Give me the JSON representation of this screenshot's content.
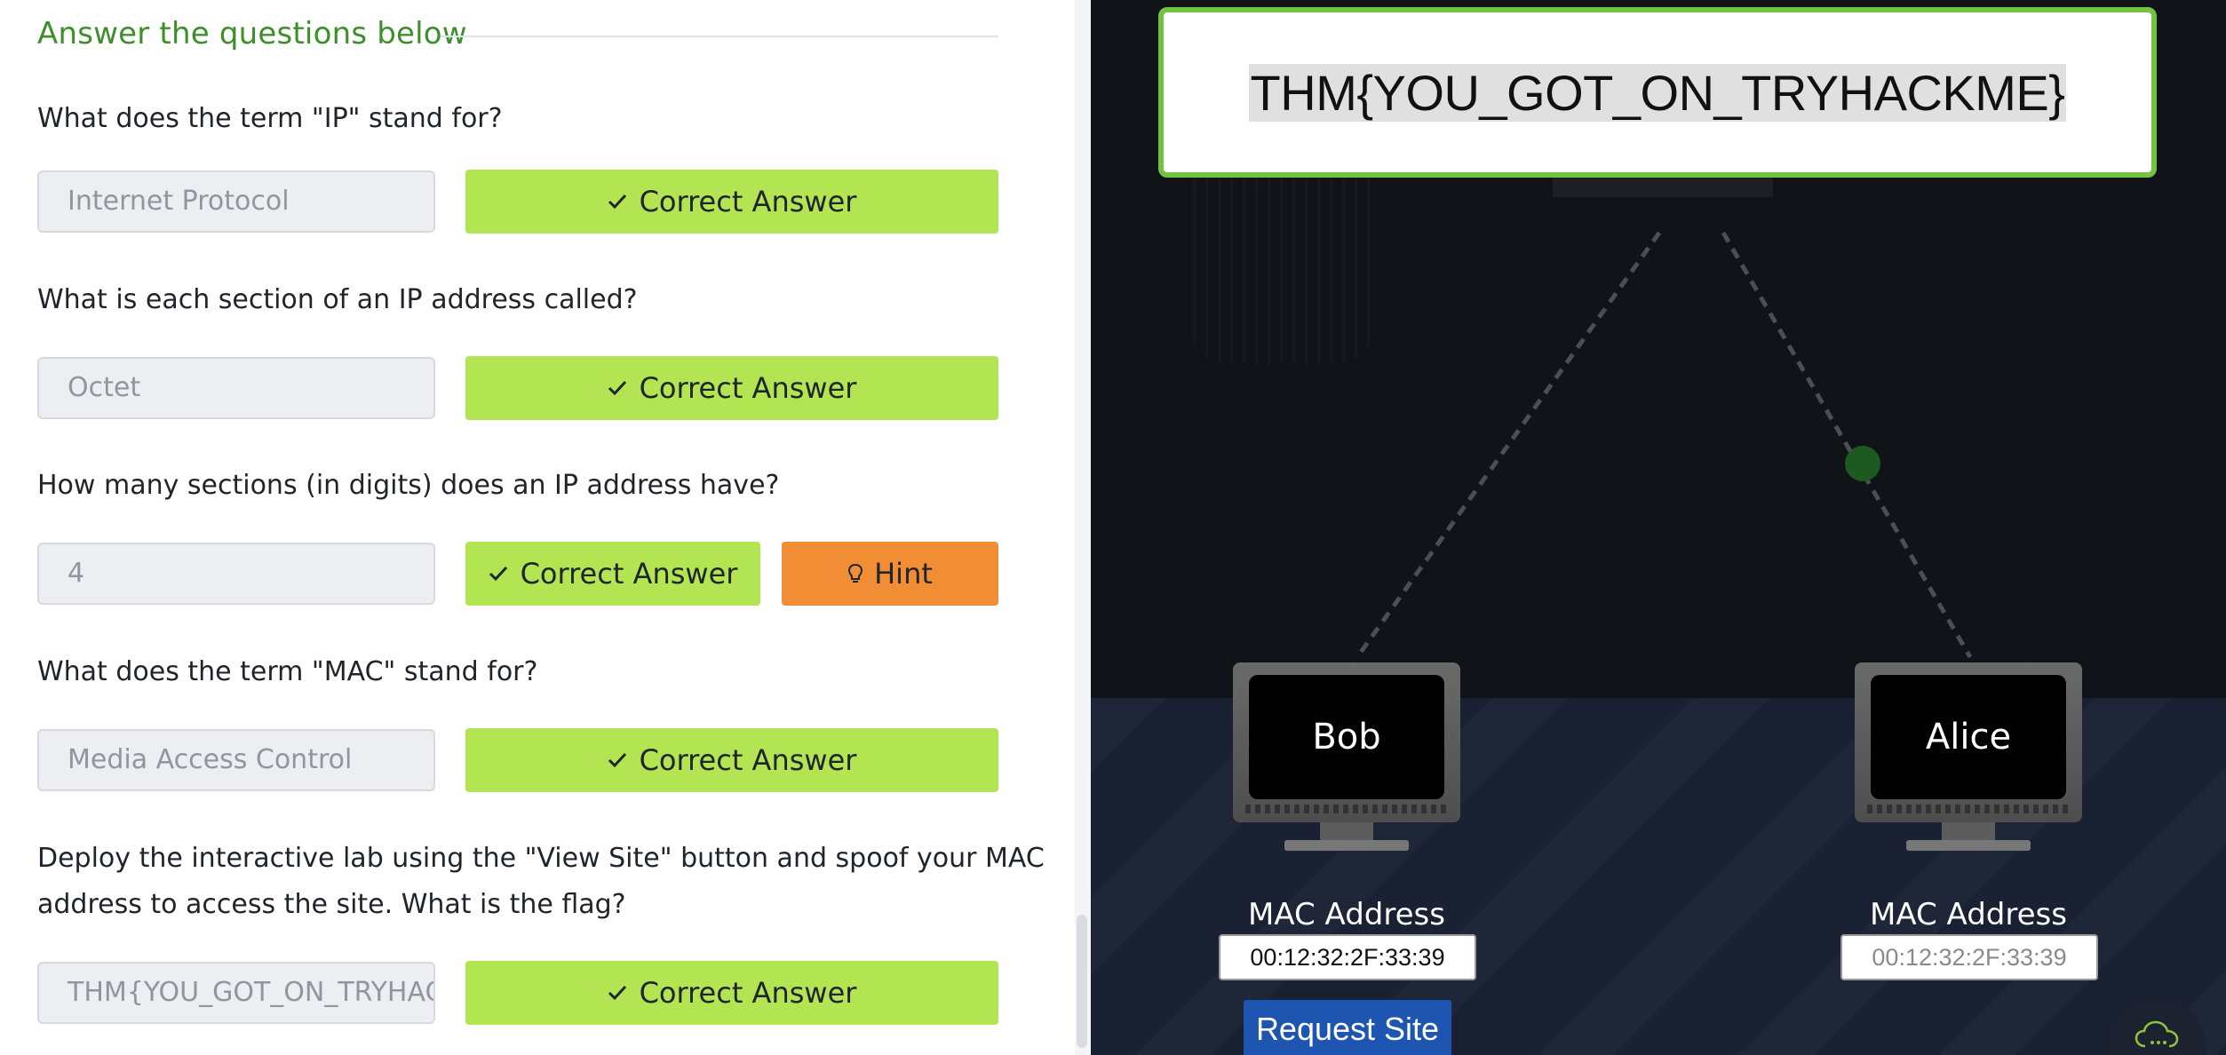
{
  "section": {
    "title": "Answer the questions below"
  },
  "questions": [
    {
      "text": "What does the term \"IP\" stand for?",
      "answer": "Internet Protocol",
      "button": "Correct Answer"
    },
    {
      "text": "What is each section of an IP address called?",
      "answer": "Octet",
      "button": "Correct Answer"
    },
    {
      "text": "How many sections (in digits) does an IP address have?",
      "answer": "4",
      "button": "Correct Answer",
      "hint": "Hint"
    },
    {
      "text": "What does the term \"MAC\" stand for?",
      "answer": "Media Access Control",
      "button": "Correct Answer"
    },
    {
      "text_line1": "Deploy the interactive lab using the \"View Site\" button and spoof your MAC",
      "text_line2": "address to access the site.  What is the flag?",
      "answer": "THM{YOU_GOT_ON_TRYHACK",
      "button": "Correct Answer"
    }
  ],
  "lab": {
    "flag": "THM{YOU_GOT_ON_TRYHACKME}",
    "bob": {
      "name": "Bob",
      "mac_label": "MAC Address",
      "mac": "00:12:32:2F:33:39"
    },
    "alice": {
      "name": "Alice",
      "mac_label": "MAC Address",
      "mac": "00:12:32:2F:33:39"
    },
    "request_button": "Request Site"
  },
  "colors": {
    "correct": "#b3e553",
    "hint": "#f18d35",
    "title_green": "#3e8f2b",
    "flag_border": "#73c243",
    "request_blue": "#1e55b0"
  },
  "icons": [
    "check-icon",
    "lightbulb-icon",
    "chat-cloud-icon"
  ]
}
